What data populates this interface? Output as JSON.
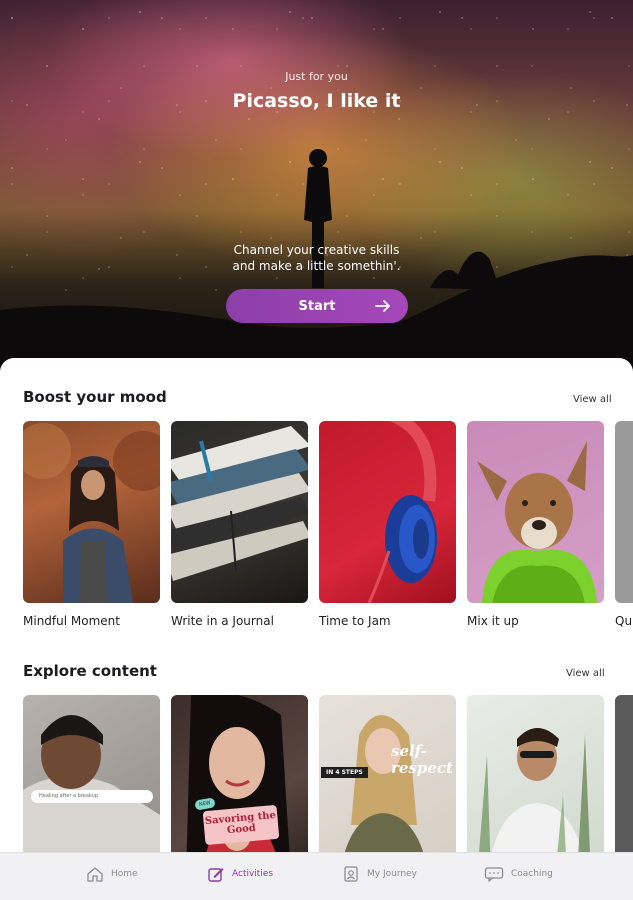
{
  "hero": {
    "eyebrow": "Just for you",
    "title": "Picasso, I like it",
    "subtitle_line1": "Channel your creative skills",
    "subtitle_line2": "and make a little somethin'.",
    "start_label": "Start"
  },
  "sections": {
    "boost": {
      "title": "Boost your mood",
      "view_all": "View all",
      "cards": [
        {
          "label": "Mindful Moment"
        },
        {
          "label": "Write in a Journal"
        },
        {
          "label": "Time to Jam"
        },
        {
          "label": "Mix it up"
        },
        {
          "label": "Qu"
        }
      ]
    },
    "explore": {
      "title": "Explore content",
      "view_all": "View all",
      "overlays": {
        "search_pill": "Healing after a breakup",
        "badge_new": "NEW",
        "savoring": "Savoring the Good",
        "in_steps": "IN 4 STEPS",
        "self_respect": "self-respect"
      }
    }
  },
  "nav": {
    "items": [
      {
        "label": "Home",
        "icon": "home-icon"
      },
      {
        "label": "Activities",
        "icon": "pencil-square-icon",
        "active": true
      },
      {
        "label": "My Journey",
        "icon": "journey-icon"
      },
      {
        "label": "Coaching",
        "icon": "chat-icon"
      }
    ],
    "active_color": "#8e3aa8"
  },
  "colors": {
    "accent": "#9a42b1"
  }
}
